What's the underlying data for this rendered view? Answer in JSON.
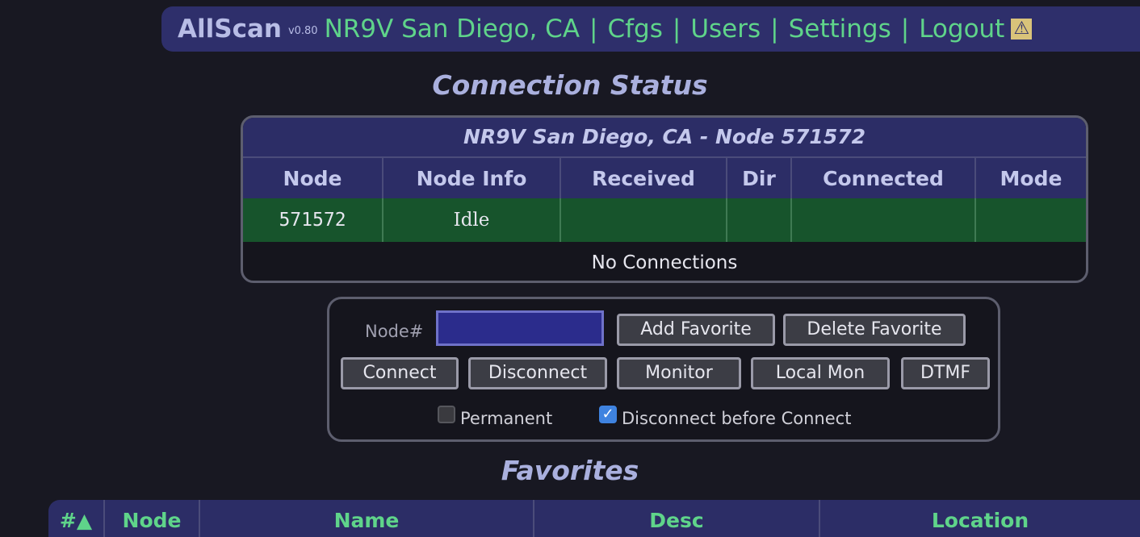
{
  "header": {
    "brand": "AllScan",
    "version": "v0.80",
    "station": "NR9V San Diego, CA",
    "links": [
      "Cfgs",
      "Users",
      "Settings",
      "Logout"
    ],
    "warn_icon": "warning-icon"
  },
  "connection_status": {
    "title": "Connection Status",
    "caption": "NR9V San Diego, CA - Node 571572",
    "columns": [
      "Node",
      "Node Info",
      "Received",
      "Dir",
      "Connected",
      "Mode"
    ],
    "row": {
      "node": "571572",
      "info": "Idle",
      "received": "",
      "dir": "",
      "connected": "",
      "mode": ""
    },
    "empty_text": "No Connections"
  },
  "controls": {
    "node_label": "Node#",
    "node_value": "",
    "add_favorite": "Add Favorite",
    "delete_favorite": "Delete Favorite",
    "connect": "Connect",
    "disconnect": "Disconnect",
    "monitor": "Monitor",
    "local_mon": "Local Mon",
    "dtmf": "DTMF",
    "permanent_label": "Permanent",
    "permanent_checked": false,
    "disconnect_before_label": "Disconnect before Connect",
    "disconnect_before_checked": true
  },
  "favorites": {
    "title": "Favorites",
    "columns": [
      "#▲",
      "Node",
      "Name",
      "Desc",
      "Location"
    ]
  },
  "colors": {
    "background": "#181822",
    "header_bg": "#2e2f6b",
    "accent_green": "#5fd48a",
    "row_green": "#17542c"
  }
}
